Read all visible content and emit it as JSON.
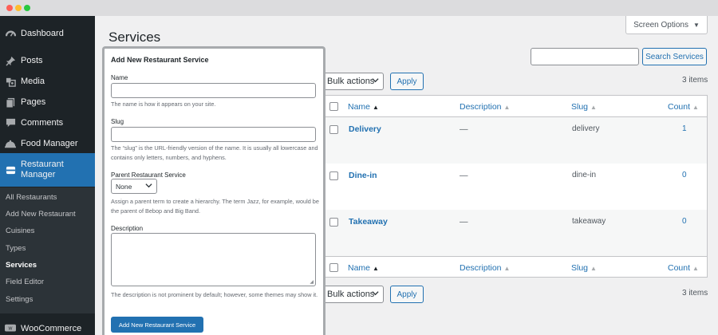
{
  "sidebar": {
    "items": [
      {
        "label": "Dashboard",
        "icon": "dashboard-icon"
      },
      {
        "label": "Posts",
        "icon": "pin-icon"
      },
      {
        "label": "Media",
        "icon": "media-icon"
      },
      {
        "label": "Pages",
        "icon": "pages-icon"
      },
      {
        "label": "Comments",
        "icon": "comments-icon"
      },
      {
        "label": "Food Manager",
        "icon": "food-manager-icon"
      },
      {
        "label": "Restaurant Manager",
        "icon": "restaurant-manager-icon"
      },
      {
        "label": "WooCommerce",
        "icon": "woocommerce-icon"
      }
    ],
    "submenu": [
      "All Restaurants",
      "Add New Restaurant",
      "Cuisines",
      "Types",
      "Services",
      "Field Editor",
      "Settings"
    ],
    "current_submenu": "Services",
    "colors": {
      "background": "#1d2327",
      "active": "#2271b1",
      "submenu": "#2c3338"
    }
  },
  "page": {
    "title": "Services",
    "screen_options": "Screen Options",
    "search_button": "Search Services",
    "bulk_actions": "Bulk actions",
    "apply": "Apply",
    "items_count": "3 items"
  },
  "table": {
    "columns": {
      "name": "Name",
      "description": "Description",
      "slug": "Slug",
      "count": "Count"
    },
    "rows": [
      {
        "name": "Delivery",
        "description": "—",
        "slug": "delivery",
        "count": "1"
      },
      {
        "name": "Dine-in",
        "description": "—",
        "slug": "dine-in",
        "count": "0"
      },
      {
        "name": "Takeaway",
        "description": "—",
        "slug": "takeaway",
        "count": "0"
      }
    ]
  },
  "form": {
    "title": "Add New Restaurant Service",
    "name_label": "Name",
    "name_help": "The name is how it appears on your site.",
    "slug_label": "Slug",
    "slug_help": "The “slug” is the URL-friendly version of the name. It is usually all lowercase and contains only letters, numbers, and hyphens.",
    "parent_label": "Parent Restaurant Service",
    "parent_value": "None",
    "parent_help": "Assign a parent term to create a hierarchy. The term Jazz, for example, would be the parent of Bebop and Big Band.",
    "description_label": "Description",
    "description_help": "The description is not prominent by default; however, some themes may show it.",
    "submit": "Add New Restaurant Service"
  }
}
